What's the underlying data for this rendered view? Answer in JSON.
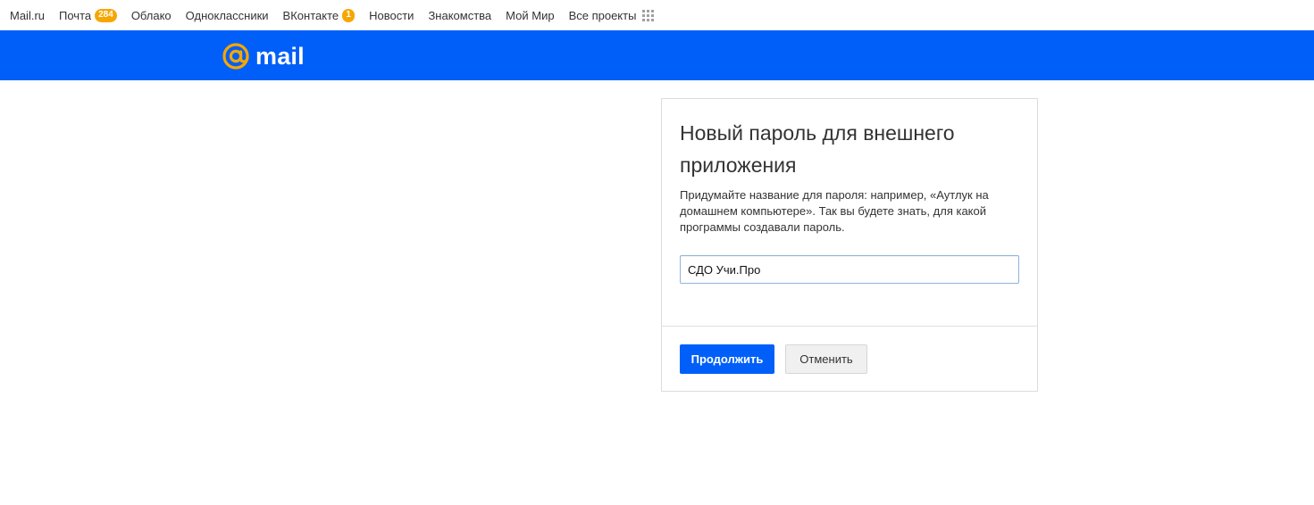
{
  "portal_bar": {
    "items": [
      {
        "label": "Mail.ru"
      },
      {
        "label": "Почта",
        "badge": "284"
      },
      {
        "label": "Облако"
      },
      {
        "label": "Одноклассники"
      },
      {
        "label": "ВКонтакте",
        "badge": "1"
      },
      {
        "label": "Новости"
      },
      {
        "label": "Знакомства"
      },
      {
        "label": "Мой Мир"
      },
      {
        "label": "Все проекты",
        "icon": "grid-icon"
      }
    ]
  },
  "header": {
    "logo_text": "mail",
    "logo_icon": "at-sign-logo-icon",
    "background_color": "#005ff9",
    "logo_accent_color": "#f7a600"
  },
  "dialog": {
    "title": "Новый пароль для внешнего приложения",
    "description": "Придумайте название для пароля: например, «Аутлук на домашнем компьютере». Так вы будете знать, для какой программы создавали пароль.",
    "input_value": "СДО Учи.Про",
    "continue_label": "Продолжить",
    "cancel_label": "Отменить"
  }
}
